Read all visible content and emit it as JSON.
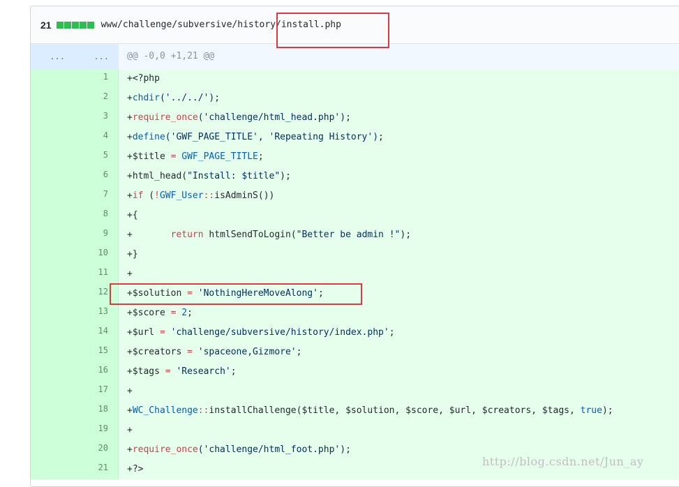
{
  "file": {
    "additions": "21",
    "path": "www/challenge/subversive/history/install.php",
    "stat_blocks": 5
  },
  "hunk": {
    "old_num": "...",
    "new_num": "...",
    "header": "@@ -0,0 +1,21 @@"
  },
  "lines": [
    {
      "num": "1",
      "tokens": [
        [
          "",
          "+<?php"
        ]
      ]
    },
    {
      "num": "2",
      "tokens": [
        [
          "",
          "+"
        ],
        [
          "f",
          "chdir"
        ],
        [
          "s",
          "('../../')"
        ],
        [
          "",
          ";"
        ]
      ]
    },
    {
      "num": "3",
      "tokens": [
        [
          "",
          "+"
        ],
        [
          "k",
          "require_once"
        ],
        [
          "s",
          "('challenge/html_head.php')"
        ],
        [
          "",
          ";"
        ]
      ]
    },
    {
      "num": "4",
      "tokens": [
        [
          "",
          "+"
        ],
        [
          "f",
          "define"
        ],
        [
          "s",
          "('GWF_PAGE_TITLE', 'Repeating History')"
        ],
        [
          "",
          ";"
        ]
      ]
    },
    {
      "num": "5",
      "tokens": [
        [
          "",
          "+$title "
        ],
        [
          "k",
          "="
        ],
        [
          "",
          " "
        ],
        [
          "c",
          "GWF_PAGE_TITLE"
        ],
        [
          "",
          ";"
        ]
      ]
    },
    {
      "num": "6",
      "tokens": [
        [
          "",
          "+html_head("
        ],
        [
          "s",
          "\"Install: $title\""
        ],
        [
          "",
          ");"
        ]
      ]
    },
    {
      "num": "7",
      "tokens": [
        [
          "",
          "+"
        ],
        [
          "k",
          "if"
        ],
        [
          "",
          " ("
        ],
        [
          "k",
          "!"
        ],
        [
          "c",
          "GWF_User"
        ],
        [
          "k",
          "::"
        ],
        [
          "",
          "isAdminS())"
        ]
      ]
    },
    {
      "num": "8",
      "tokens": [
        [
          "",
          "+{"
        ]
      ]
    },
    {
      "num": "9",
      "tokens": [
        [
          "",
          "+       "
        ],
        [
          "k",
          "return"
        ],
        [
          "",
          " htmlSendToLogin("
        ],
        [
          "s",
          "\"Better be admin !\""
        ],
        [
          "",
          ");"
        ]
      ]
    },
    {
      "num": "10",
      "tokens": [
        [
          "",
          "+}"
        ]
      ]
    },
    {
      "num": "11",
      "tokens": [
        [
          "",
          "+"
        ]
      ]
    },
    {
      "num": "12",
      "tokens": [
        [
          "",
          "+$solution "
        ],
        [
          "k",
          "="
        ],
        [
          "",
          " "
        ],
        [
          "s",
          "'NothingHereMoveAlong'"
        ],
        [
          "",
          ";"
        ]
      ]
    },
    {
      "num": "13",
      "tokens": [
        [
          "",
          "+$score "
        ],
        [
          "k",
          "="
        ],
        [
          "",
          " "
        ],
        [
          "c",
          "2"
        ],
        [
          "",
          ";"
        ]
      ]
    },
    {
      "num": "14",
      "tokens": [
        [
          "",
          "+$url "
        ],
        [
          "k",
          "="
        ],
        [
          "",
          " "
        ],
        [
          "s",
          "'challenge/subversive/history/index.php'"
        ],
        [
          "",
          ";"
        ]
      ]
    },
    {
      "num": "15",
      "tokens": [
        [
          "",
          "+$creators "
        ],
        [
          "k",
          "="
        ],
        [
          "",
          " "
        ],
        [
          "s",
          "'spaceone,Gizmore'"
        ],
        [
          "",
          ";"
        ]
      ]
    },
    {
      "num": "16",
      "tokens": [
        [
          "",
          "+$tags "
        ],
        [
          "k",
          "="
        ],
        [
          "",
          " "
        ],
        [
          "s",
          "'Research'"
        ],
        [
          "",
          ";"
        ]
      ]
    },
    {
      "num": "17",
      "tokens": [
        [
          "",
          "+"
        ]
      ]
    },
    {
      "num": "18",
      "tokens": [
        [
          "",
          "+"
        ],
        [
          "c",
          "WC_Challenge"
        ],
        [
          "k",
          "::"
        ],
        [
          "",
          "installChallenge($title, $solution, $score, $url, $creators, $tags, "
        ],
        [
          "c",
          "true"
        ],
        [
          "",
          ");"
        ]
      ]
    },
    {
      "num": "19",
      "tokens": [
        [
          "",
          "+"
        ]
      ]
    },
    {
      "num": "20",
      "tokens": [
        [
          "",
          "+"
        ],
        [
          "k",
          "require_once"
        ],
        [
          "s",
          "('challenge/html_foot.php')"
        ],
        [
          "",
          ";"
        ]
      ]
    },
    {
      "num": "21",
      "tokens": [
        [
          "",
          "+?>"
        ]
      ]
    }
  ],
  "watermark": "http://blog.csdn.net/Jun_ay",
  "colors": {
    "addition_bg": "#e6ffed",
    "addition_num_bg": "#cdffd8",
    "hunk_bg": "#f1f8ff",
    "highlight": "#e0383e",
    "keyword": "#d73a49",
    "constant": "#005cc5",
    "string": "#032f62"
  }
}
